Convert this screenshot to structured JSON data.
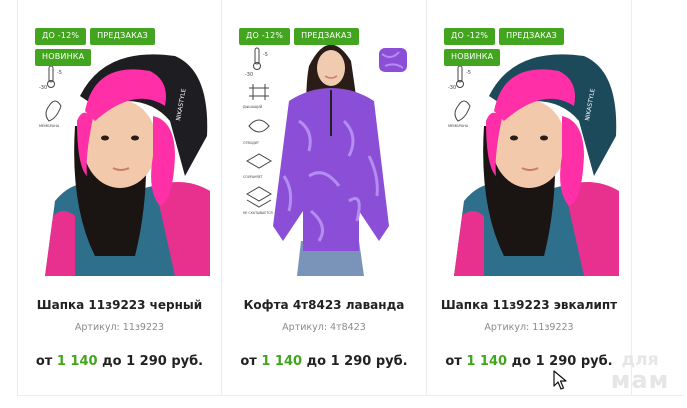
{
  "products": [
    {
      "badges": [
        "ДО -12%",
        "ПРЕДЗАКАЗ",
        "НОВИНКА"
      ],
      "title": "Шапка 11з9223 черный",
      "article": "Артикул: 11з9223",
      "price": {
        "from_label": "от",
        "from": "1 140",
        "to_label": "до",
        "to": "1 290",
        "currency": "руб."
      },
      "image_icon": "kids-hat-photo",
      "colors": {
        "hat": "#1e1e22",
        "fur": "#ff2fa8",
        "jacket": "#2e6f8c"
      }
    },
    {
      "badges": [
        "ДО -12%",
        "ПРЕДЗАКАЗ"
      ],
      "title": "Кофта 4т8423 лаванда",
      "article": "Артикул: 4т8423",
      "price": {
        "from_label": "от",
        "from": "1 140",
        "to_label": "до",
        "to": "1 290",
        "currency": "руб."
      },
      "image_icon": "fleece-jacket-photo",
      "colors": {
        "jacket": "#8a4fd6",
        "pattern": "#b58cf0",
        "jeans": "#7a93b8"
      }
    },
    {
      "badges": [
        "ДО -12%",
        "ПРЕДЗАКАЗ",
        "НОВИНКА"
      ],
      "title": "Шапка 11з9223 эвкалипт",
      "article": "Артикул: 11з9223",
      "price": {
        "from_label": "от",
        "from": "1 140",
        "to_label": "до",
        "to": "1 290",
        "currency": "руб."
      },
      "image_icon": "kids-hat-photo",
      "colors": {
        "hat": "#1d4a5a",
        "fur": "#ff2fa8",
        "jacket": "#2e6f8c"
      }
    }
  ],
  "watermark": {
    "line1": "для",
    "line2": "мам"
  },
  "accent_color": "#43a51f"
}
